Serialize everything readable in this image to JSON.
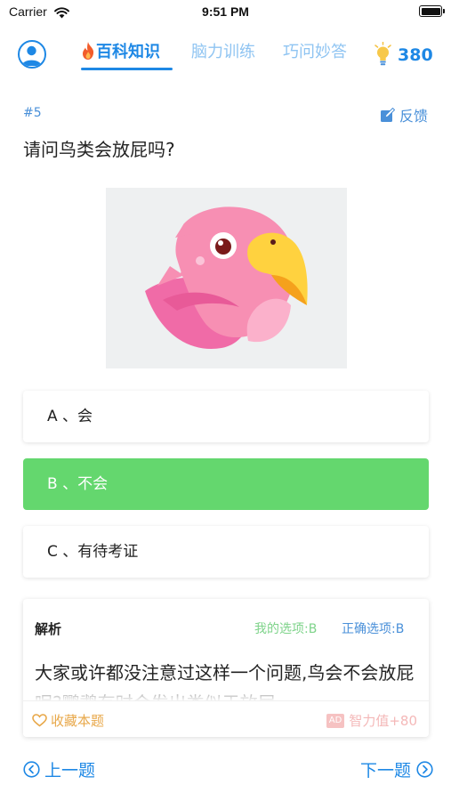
{
  "status_bar": {
    "carrier": "Carrier",
    "time": "9:51 PM"
  },
  "nav": {
    "tabs": [
      {
        "label": "百科知识",
        "active": true
      },
      {
        "label": "脑力训练",
        "active": false
      },
      {
        "label": "巧问妙答",
        "active": false
      }
    ],
    "points": "380",
    "icons": {
      "avatar": "user-avatar-icon",
      "fire": "fire-icon",
      "bulb": "lightbulb-icon"
    }
  },
  "question": {
    "number": "#5",
    "feedback_label": "反馈",
    "text": "请问鸟类会放屁吗?"
  },
  "options": [
    {
      "label": "A 、会",
      "selected": false
    },
    {
      "label": "B 、不会",
      "selected": true
    },
    {
      "label": "C 、有待考证",
      "selected": false
    }
  ],
  "analysis": {
    "title": "解析",
    "my_choice": "我的选项:B",
    "correct_choice": "正确选项:B",
    "body": "大家或许都没注意过这样一个问题,鸟会不会放屁呢?鹦鹉有时会发出类似于放屁",
    "collect_label": "收藏本题",
    "ad_badge": "AD",
    "iq_label": "智力值+80"
  },
  "footer": {
    "prev_label": "上一题",
    "next_label": "下一题"
  },
  "colors": {
    "primary": "#1e88e5",
    "selected_option": "#64d76e",
    "collect": "#e8a84a"
  }
}
